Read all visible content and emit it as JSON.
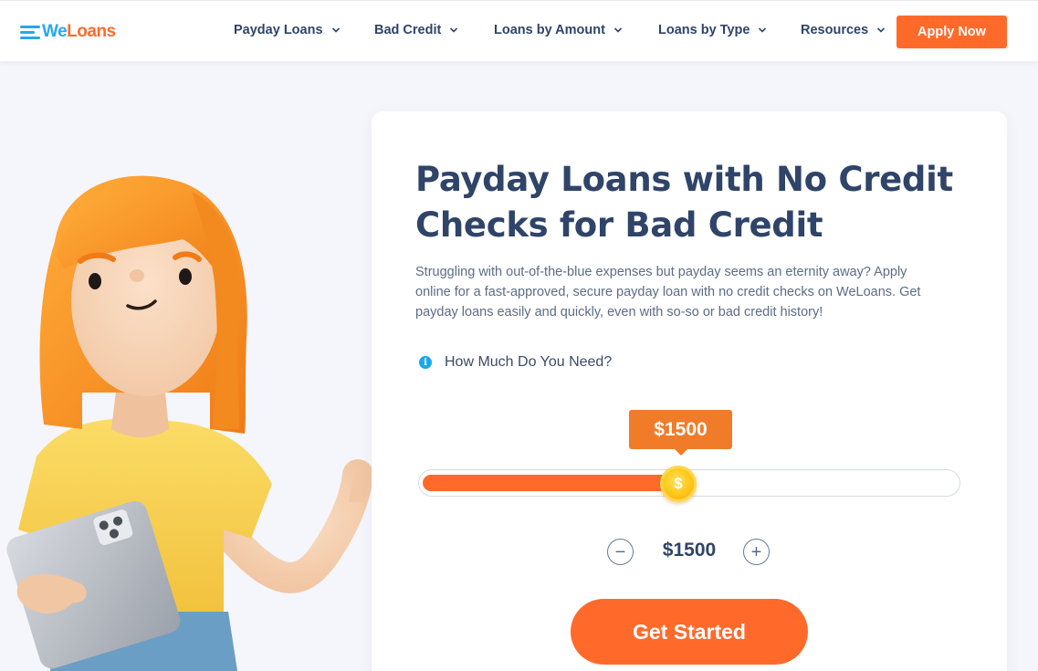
{
  "brand": {
    "logo_we": "We",
    "logo_loans": "Loans",
    "colors": {
      "primary_orange": "#ff6a2b",
      "brand_blue": "#2aa8ee",
      "navy_text": "#2f4468"
    }
  },
  "nav": {
    "items": [
      {
        "label": "Payday Loans",
        "icon": "chevron-down-icon"
      },
      {
        "label": "Bad Credit",
        "icon": "chevron-down-icon"
      },
      {
        "label": "Loans by Amount",
        "icon": "chevron-down-icon"
      },
      {
        "label": "Loans by Type",
        "icon": "chevron-down-icon"
      },
      {
        "label": "Resources",
        "icon": "chevron-down-icon"
      }
    ],
    "apply_label": "Apply Now"
  },
  "hero": {
    "title": "Payday Loans with No Credit Checks for Bad Credit",
    "description": "Struggling with out-of-the-blue expenses but payday seems an eternity away? Apply online for a fast-approved, secure payday loan with no credit checks on WeLoans. Get payday loans easily and quickly, even with so-so or bad credit history!",
    "amount_question": "How Much Do You Need?",
    "info_icon": "info-icon"
  },
  "loan_slider": {
    "tooltip": "$1500",
    "fill_fraction": 0.48,
    "thumb_icon": "dollar-coin-icon",
    "thumb_symbol": "$"
  },
  "stepper": {
    "value": "$1500",
    "minus_symbol": "−",
    "plus_symbol": "+"
  },
  "cta": {
    "label": "Get Started"
  }
}
